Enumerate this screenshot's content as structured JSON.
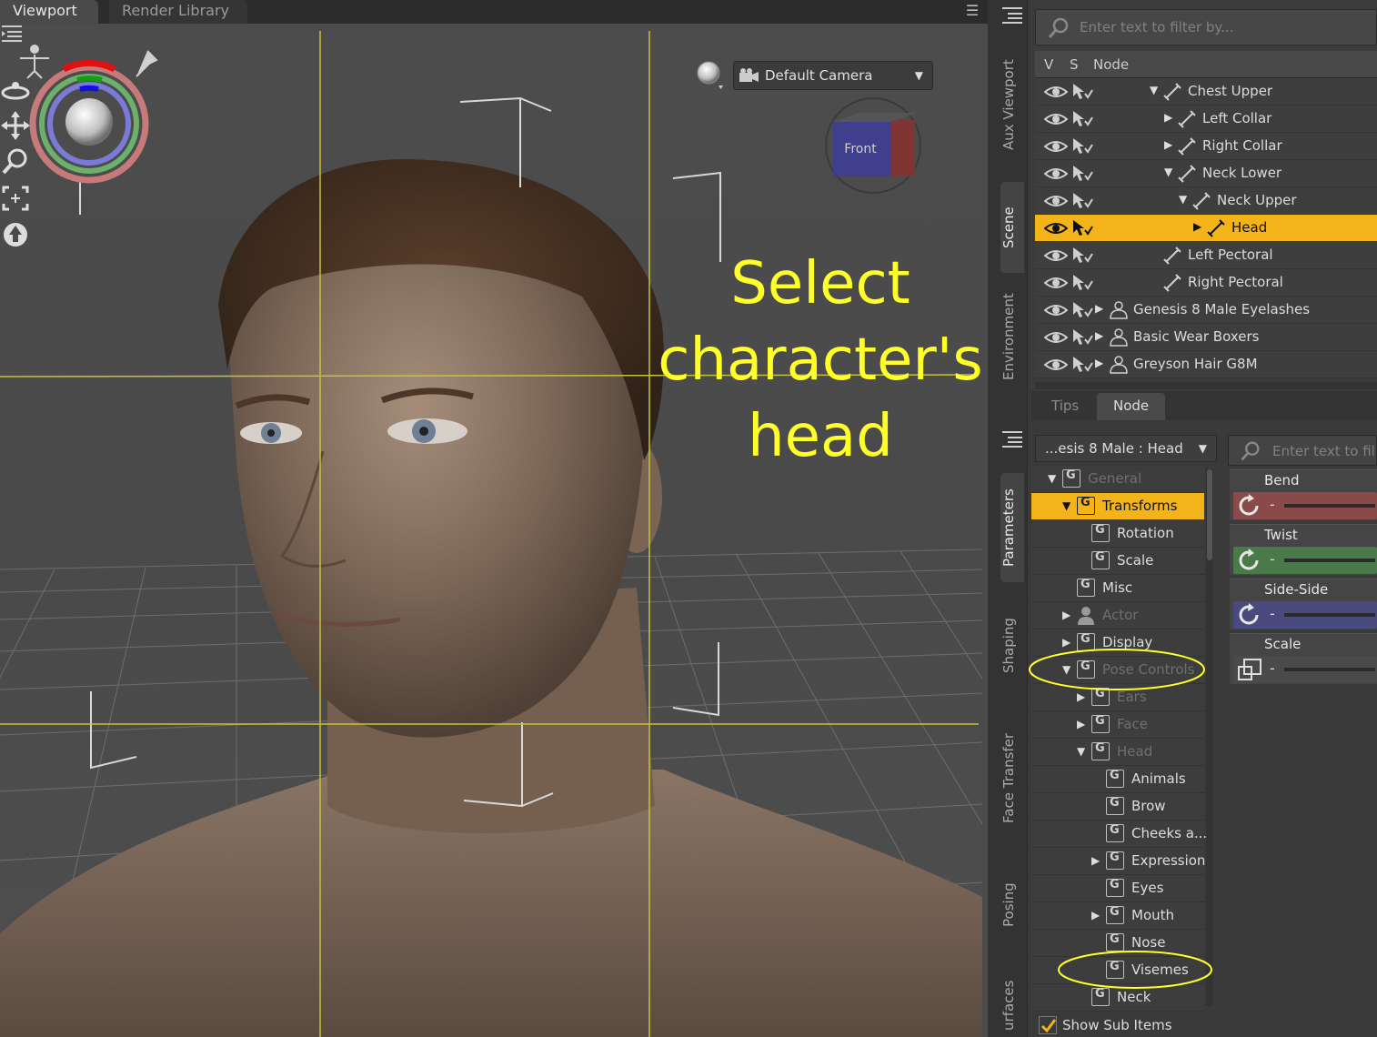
{
  "viewport": {
    "tabs": [
      {
        "label": "Viewport"
      },
      {
        "label": "Render Library"
      }
    ],
    "camera": "Default Camera",
    "cube_label_front": "Front",
    "annotation_lines": [
      "Select",
      "character's",
      "head"
    ]
  },
  "side_tabs_top": [
    "Aux Viewport",
    "Scene",
    "Environment"
  ],
  "side_tabs_bottom": [
    "Parameters",
    "Shaping",
    "Face Transfer",
    "Posing",
    "urfaces"
  ],
  "scene": {
    "filter_placeholder": "Enter text to filter by...",
    "columns": {
      "v": "V",
      "s": "S",
      "node": "Node"
    },
    "rows": [
      {
        "label": "Chest Upper",
        "arrow": "▼"
      },
      {
        "label": "Left Collar",
        "arrow": "▶"
      },
      {
        "label": "Right Collar",
        "arrow": "▶"
      },
      {
        "label": "Neck Lower",
        "arrow": "▼"
      },
      {
        "label": "Neck Upper",
        "arrow": "▼"
      },
      {
        "label": "Head",
        "arrow": "▶"
      },
      {
        "label": "Left Pectoral",
        "arrow": ""
      },
      {
        "label": "Right Pectoral",
        "arrow": ""
      },
      {
        "label": "Genesis 8 Male Eyelashes",
        "arrow": "▶"
      },
      {
        "label": "Basic Wear Boxers",
        "arrow": "▶"
      },
      {
        "label": "Greyson Hair G8M",
        "arrow": "▶"
      }
    ],
    "selected_index": 5
  },
  "subtabs": [
    {
      "label": "Tips"
    },
    {
      "label": "Node"
    }
  ],
  "parameters": {
    "node_dropdown": "...esis 8 Male : Head",
    "filter_placeholder": "Enter text to filter by...",
    "groups": [
      {
        "label": "General",
        "arrow": "▼"
      },
      {
        "label": "Transforms",
        "arrow": "▼"
      },
      {
        "label": "Rotation",
        "arrow": ""
      },
      {
        "label": "Scale",
        "arrow": ""
      },
      {
        "label": "Misc",
        "arrow": ""
      },
      {
        "label": "Actor",
        "arrow": "▶"
      },
      {
        "label": "Display",
        "arrow": "▶"
      },
      {
        "label": "Pose Controls",
        "arrow": "▼"
      },
      {
        "label": "Ears",
        "arrow": "▶"
      },
      {
        "label": "Face",
        "arrow": "▶"
      },
      {
        "label": "Head",
        "arrow": "▼"
      },
      {
        "label": "Animals",
        "arrow": ""
      },
      {
        "label": "Brow",
        "arrow": ""
      },
      {
        "label": "Cheeks a...",
        "arrow": ""
      },
      {
        "label": "Expressions",
        "arrow": "▶"
      },
      {
        "label": "Eyes",
        "arrow": ""
      },
      {
        "label": "Mouth",
        "arrow": "▶"
      },
      {
        "label": "Nose",
        "arrow": ""
      },
      {
        "label": "Visemes",
        "arrow": ""
      },
      {
        "label": "Neck",
        "arrow": ""
      }
    ],
    "active_index": 1,
    "show_sub_items": "Show Sub Items",
    "sliders": [
      {
        "name": "Bend",
        "color": "#8a4a4a"
      },
      {
        "name": "Twist",
        "color": "#4a7a4a"
      },
      {
        "name": "Side-Side",
        "color": "#4a4a7e"
      },
      {
        "name": "Scale",
        "color": "#4a4a4a"
      }
    ]
  },
  "colors": {
    "accent": "#f2b418",
    "annotation": "#ffff2a",
    "guide_line": "#c8c23a"
  }
}
